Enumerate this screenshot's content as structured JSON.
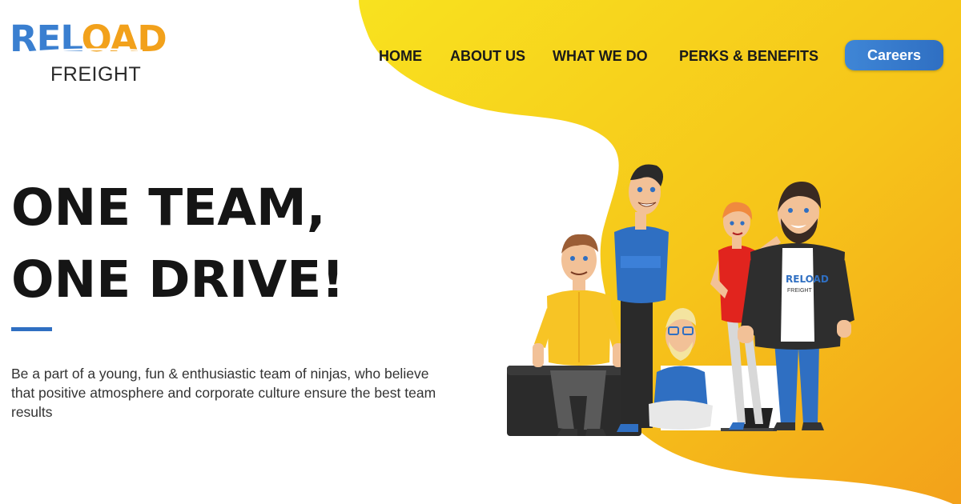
{
  "logo": {
    "reload_a": "REL",
    "reload_b": "OAD",
    "freight": "FREIGHT"
  },
  "nav": {
    "home": "HOME",
    "about": "ABOUT US",
    "what": "WHAT WE DO",
    "perks": "PERKS & BENEFITS",
    "careers": "Careers"
  },
  "hero": {
    "line1": "ONE TEAM,",
    "line2": "ONE DRIVE!",
    "description": "Be a part of a young, fun & enthusiastic team of ninjas, who believe that positive atmosphere and corporate culture ensure the best team results"
  },
  "illustration": {
    "shirt_logo_a": "RELOAD",
    "shirt_logo_b": "FREIGHT"
  },
  "colors": {
    "blue": "#2f6fc2",
    "yellow": "#f5c31a",
    "orange": "#f2a11b"
  }
}
